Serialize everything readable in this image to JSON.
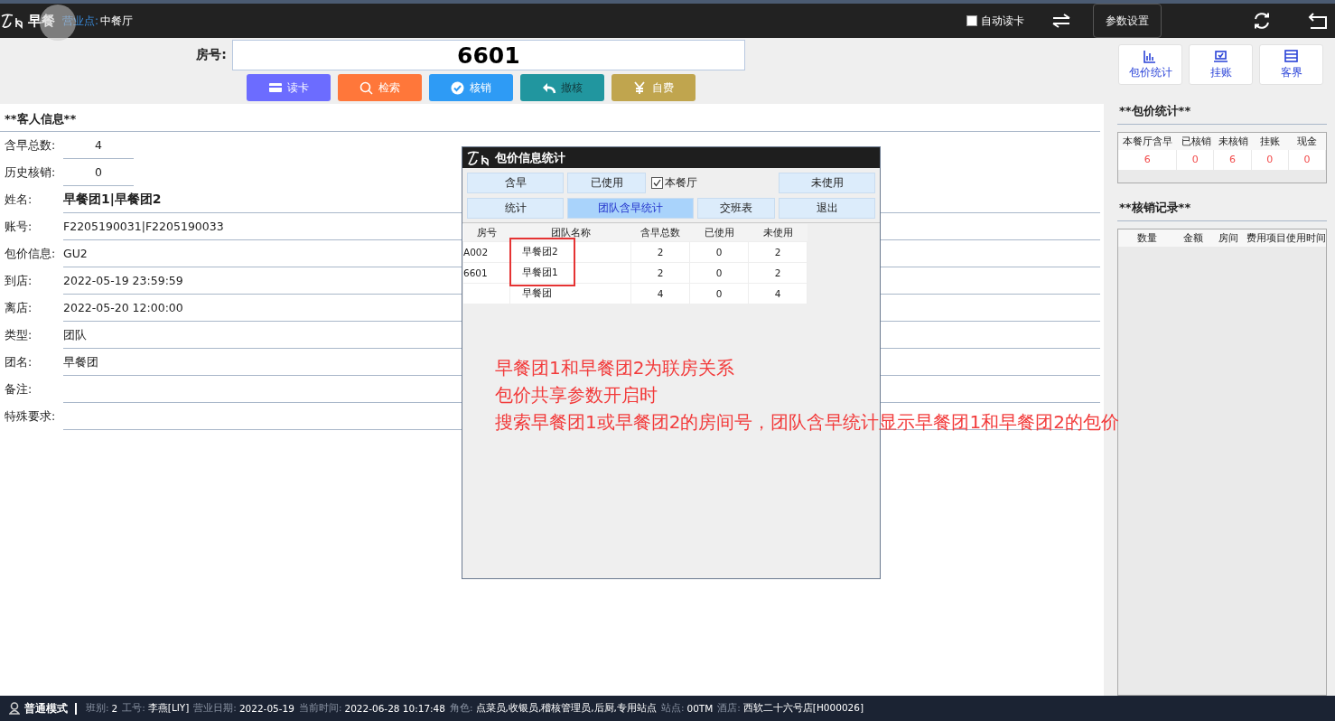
{
  "top_bar": {
    "app_title": "早餐",
    "outlet_label": "营业点:",
    "outlet": "中餐厅",
    "auto_read_card": {
      "label": "自动读卡",
      "checked": false
    },
    "settings_button": "参数设置"
  },
  "search": {
    "label": "房号:",
    "value": "6601"
  },
  "actions": [
    {
      "label": "读卡",
      "kind": "card",
      "color": "#6c6cff",
      "disabled": false
    },
    {
      "label": "检索",
      "kind": "search",
      "color": "#ff773a",
      "disabled": false
    },
    {
      "label": "核销",
      "kind": "check",
      "color": "#2e9bf5",
      "disabled": false
    },
    {
      "label": "撤核",
      "kind": "undo",
      "color": "#21969f",
      "disabled": true
    },
    {
      "label": "自费",
      "kind": "yen",
      "color": "#c0a54e",
      "disabled": false
    }
  ],
  "guest_info": {
    "title": "**客人信息**",
    "summary": [
      {
        "label": "含早总数:",
        "value": "4"
      },
      {
        "label": "历史核销:",
        "value": "0"
      }
    ],
    "fields": [
      {
        "label": "姓名:",
        "value": "早餐团1|早餐团2",
        "bold": true
      },
      {
        "label": "账号:",
        "value": "F2205190031|F2205190033",
        "bold": false
      },
      {
        "label": "包价信息:",
        "value": "GU2",
        "bold": false
      },
      {
        "label": "到店:",
        "value": "2022-05-19 23:59:59",
        "bold": false
      },
      {
        "label": "离店:",
        "value": "2022-05-20 12:00:00",
        "bold": false
      },
      {
        "label": "类型:",
        "value": "团队",
        "bold": false
      },
      {
        "label": "团名:",
        "value": "早餐团",
        "bold": false
      },
      {
        "label": "备注:"
      },
      {
        "label": "特殊要求:"
      }
    ]
  },
  "dialog": {
    "title": "包价信息统计",
    "button_rows": [
      [
        {
          "kind": "button",
          "label": "含早",
          "selected": false
        },
        {
          "kind": "button",
          "label": "已使用",
          "selected": false
        },
        {
          "kind": "checkbox",
          "label": "本餐厅",
          "checked": true
        },
        {
          "kind": "button",
          "label": "未使用",
          "selected": false
        }
      ],
      [
        {
          "kind": "button",
          "label": "统计",
          "selected": false
        },
        {
          "kind": "button",
          "label": "团队含早统计",
          "selected": true
        },
        {
          "kind": "button",
          "label": "交班表",
          "selected": false
        },
        {
          "kind": "button",
          "label": "退出",
          "selected": false
        }
      ]
    ],
    "table": {
      "columns": [
        "房号",
        "团队名称",
        "含早总数",
        "已使用",
        "未使用"
      ],
      "rows": [
        [
          "A002",
          "早餐团2",
          "2",
          "0",
          "2"
        ],
        [
          "6601",
          "早餐团1",
          "2",
          "0",
          "2"
        ],
        [
          "",
          "早餐团",
          "4",
          "0",
          "4"
        ]
      ]
    }
  },
  "annotation": {
    "lines": [
      "早餐团1和早餐团2为联房关系",
      "包价共享参数开启时",
      "搜索早餐团1或早餐团2的房间号，团队含早统计显示早餐团1和早餐团2的包价"
    ]
  },
  "right_panel": {
    "buttons": [
      {
        "label": "包价统计",
        "kind": "chart"
      },
      {
        "label": "挂账",
        "kind": "laptop"
      },
      {
        "label": "客界",
        "kind": "window"
      }
    ],
    "package_stats": {
      "title": "**包价统计**",
      "columns": [
        "本餐厅含早",
        "已核销",
        "未核销",
        "挂账",
        "现金"
      ],
      "values": [
        "6",
        "0",
        "6",
        "0",
        "0"
      ]
    },
    "writeoff_records": {
      "title": "**核销记录**",
      "columns": [
        "数量",
        "金额",
        "房间",
        "费用项目",
        "使用时间"
      ]
    }
  },
  "status_bar": {
    "mode": "普通模式",
    "fields": [
      {
        "label": "班别:",
        "value": "2"
      },
      {
        "label": "工号:",
        "value": "李燕[LIY]"
      },
      {
        "label": "营业日期:",
        "value": "2022-05-19"
      },
      {
        "label": "当前时间:",
        "value": "2022-06-28 10:17:48"
      },
      {
        "label": "角色:",
        "value": "点菜员,收银员,稽核管理员,后厨,专用站点"
      },
      {
        "label": "站点:",
        "value": "00TM"
      },
      {
        "label": "酒店:",
        "value": "西软二十六号店[H000026]"
      }
    ]
  }
}
